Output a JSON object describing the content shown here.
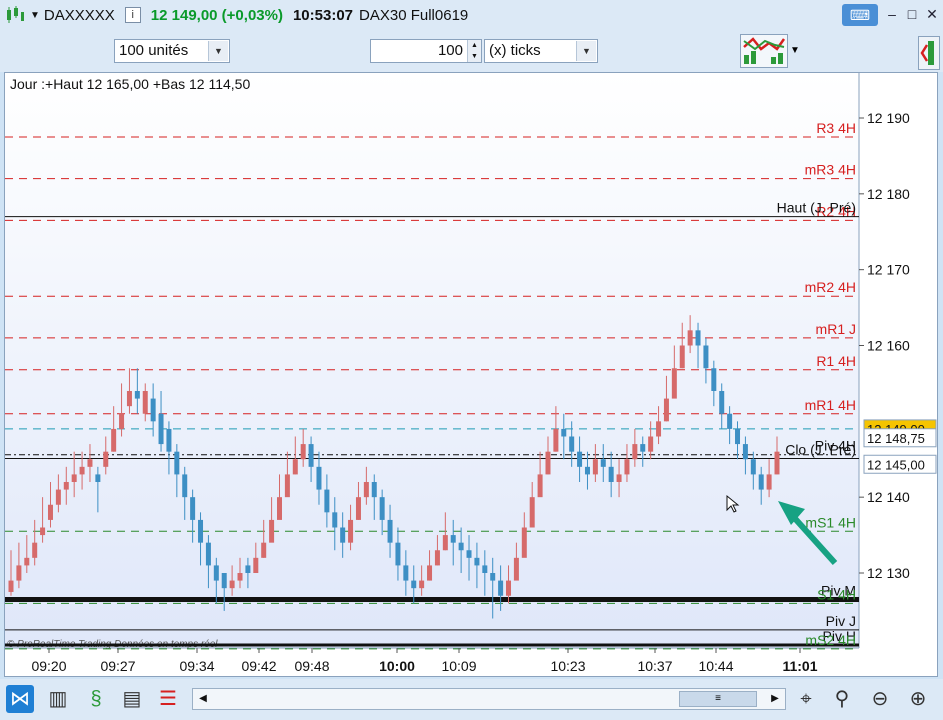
{
  "titlebar": {
    "symbol": "DAXXXXX",
    "info": "i",
    "price": "12 149,00 (+0,03%)",
    "time": "10:53:07",
    "instrument": "DAX30 Full0619",
    "min": "–",
    "max": "□",
    "close": "✕"
  },
  "toolbar": {
    "units_value": "100 unités",
    "ticks_value": "100",
    "ticks_mode": "(x) ticks"
  },
  "chart": {
    "header": "Jour :+Haut 12 165,00 +Bas 12 114,50",
    "watermark": "© ProRealTime Trading Données en temps réel",
    "y_ticks": [
      {
        "v": 12190,
        "label": "12 190"
      },
      {
        "v": 12180,
        "label": "12 180"
      },
      {
        "v": 12170,
        "label": "12 170"
      },
      {
        "v": 12160,
        "label": "12 160"
      },
      {
        "v": 12140,
        "label": "12 140"
      },
      {
        "v": 12130,
        "label": "12 130"
      }
    ],
    "x_ticks": [
      {
        "label": "09:20",
        "bold": false
      },
      {
        "label": "09:27",
        "bold": false
      },
      {
        "label": "09:34",
        "bold": false
      },
      {
        "label": "09:42",
        "bold": false
      },
      {
        "label": "09:48",
        "bold": false
      },
      {
        "label": "10:00",
        "bold": true
      },
      {
        "label": "10:09",
        "bold": false
      },
      {
        "label": "10:23",
        "bold": false
      },
      {
        "label": "10:37",
        "bold": false
      },
      {
        "label": "10:44",
        "bold": false
      },
      {
        "label": "11:01",
        "bold": true
      }
    ],
    "price_tags": [
      {
        "label": "12 149,00",
        "v": 12149,
        "bg": "#f5c400"
      },
      {
        "label": "12 148,75",
        "v": 12147.7,
        "bg": "#ffffff"
      },
      {
        "label": "12 145,00",
        "v": 12145,
        "bg": "#ffffff"
      }
    ],
    "levels": [
      {
        "label": "R3 4H",
        "v": 12187.5,
        "color": "#d62020",
        "style": "dash"
      },
      {
        "label": "mR3 4H",
        "v": 12182,
        "color": "#d62020",
        "style": "dash"
      },
      {
        "label": "R2 4H",
        "v": 12176.5,
        "color": "#d62020",
        "style": "dash"
      },
      {
        "label": "Haut (J. Pré)",
        "v": 12177,
        "color": "#111111",
        "style": "solid"
      },
      {
        "label": "mR2 4H",
        "v": 12166.5,
        "color": "#d62020",
        "style": "dash"
      },
      {
        "label": "mR1 J",
        "v": 12161,
        "color": "#d62020",
        "style": "dash"
      },
      {
        "label": "R1 4H",
        "v": 12156.8,
        "color": "#d62020",
        "style": "dash"
      },
      {
        "label": "mR1 4H",
        "v": 12151,
        "color": "#d62020",
        "style": "dash"
      },
      {
        "label": "",
        "v": 12149,
        "color": "#1f9bb5",
        "style": "dash"
      },
      {
        "label": "Piv 4H",
        "v": 12145.6,
        "color": "#111111",
        "style": "dashdot"
      },
      {
        "label": "Clo (J. Pré)",
        "v": 12145.1,
        "color": "#111111",
        "style": "solid"
      },
      {
        "label": "mS1 4H",
        "v": 12135.5,
        "color": "#2a8a2a",
        "style": "dash"
      },
      {
        "label": "Piv M",
        "v": 12126.5,
        "color": "#111111",
        "style": "thick"
      },
      {
        "label": "S1 4H",
        "v": 12126,
        "color": "#2a8a2a",
        "style": "dash"
      },
      {
        "label": "Piv J",
        "v": 12122.5,
        "color": "#111111",
        "style": "solid"
      },
      {
        "label": "Piv H",
        "v": 12120.5,
        "color": "#111111",
        "style": "thick2"
      },
      {
        "label": "mS2 4H",
        "v": 12120,
        "color": "#2a8a2a",
        "style": "dash"
      }
    ],
    "colors": {
      "up": "#3d8fc4",
      "down": "#d66a6a",
      "bg_top": "#ffffff",
      "bg_bottom": "#dfe7f9"
    }
  },
  "chart_data": {
    "type": "candlestick",
    "x_labels": [
      "09:20",
      "09:27",
      "09:34",
      "09:42",
      "09:48",
      "10:00",
      "10:09",
      "10:23",
      "10:37",
      "10:44",
      "11:01"
    ],
    "ylim": [
      12115,
      12198
    ],
    "candles": [
      [
        12129,
        12133,
        12127,
        12127.5
      ],
      [
        12131,
        12134,
        12128,
        12129
      ],
      [
        12132,
        12135,
        12130,
        12131
      ],
      [
        12134,
        12137,
        12131,
        12132
      ],
      [
        12136,
        12140,
        12134,
        12135
      ],
      [
        12139,
        12142,
        12136,
        12137
      ],
      [
        12141,
        12143,
        12138,
        12139
      ],
      [
        12142,
        12144,
        12139,
        12141
      ],
      [
        12143,
        12146,
        12140,
        12142
      ],
      [
        12144,
        12146,
        12141,
        12143
      ],
      [
        12145,
        12147,
        12142,
        12144
      ],
      [
        12142,
        12144,
        12138,
        12143
      ],
      [
        12146,
        12148,
        12143,
        12144
      ],
      [
        12149,
        12152,
        12146,
        12146
      ],
      [
        12151,
        12155,
        12148,
        12149
      ],
      [
        12154,
        12157,
        12151,
        12152
      ],
      [
        12153,
        12157,
        12151,
        12154
      ],
      [
        12154,
        12155,
        12150,
        12151
      ],
      [
        12150,
        12155,
        12148,
        12153
      ],
      [
        12147,
        12154,
        12146,
        12151
      ],
      [
        12146,
        12150,
        12143,
        12149
      ],
      [
        12143,
        12147,
        12140,
        12146
      ],
      [
        12140,
        12144,
        12137,
        12143
      ],
      [
        12137,
        12141,
        12134,
        12140
      ],
      [
        12134,
        12138,
        12131,
        12137
      ],
      [
        12131,
        12135,
        12128,
        12134
      ],
      [
        12129,
        12132,
        12126,
        12131
      ],
      [
        12128,
        12130,
        12125,
        12130
      ],
      [
        12129,
        12131,
        12127,
        12128
      ],
      [
        12130,
        12132,
        12128,
        12129
      ],
      [
        12130,
        12132,
        12128,
        12131
      ],
      [
        12132,
        12134,
        12130,
        12130
      ],
      [
        12134,
        12137,
        12132,
        12132
      ],
      [
        12137,
        12140,
        12135,
        12134
      ],
      [
        12140,
        12143,
        12138,
        12137
      ],
      [
        12143,
        12146,
        12141,
        12140
      ],
      [
        12145,
        12148,
        12143,
        12143
      ],
      [
        12147,
        12149,
        12144,
        12145
      ],
      [
        12144,
        12148,
        12142,
        12147
      ],
      [
        12141,
        12146,
        12139,
        12144
      ],
      [
        12138,
        12143,
        12136,
        12141
      ],
      [
        12136,
        12140,
        12133,
        12138
      ],
      [
        12134,
        12138,
        12132,
        12136
      ],
      [
        12137,
        12139,
        12133,
        12134
      ],
      [
        12140,
        12142,
        12137,
        12137
      ],
      [
        12142,
        12144,
        12139,
        12140
      ],
      [
        12140,
        12143,
        12137,
        12142
      ],
      [
        12137,
        12141,
        12135,
        12140
      ],
      [
        12134,
        12139,
        12132,
        12137
      ],
      [
        12131,
        12136,
        12129,
        12134
      ],
      [
        12129,
        12133,
        12127,
        12131
      ],
      [
        12128,
        12131,
        12126,
        12129
      ],
      [
        12129,
        12131,
        12127,
        12128
      ],
      [
        12131,
        12133,
        12129,
        12129
      ],
      [
        12133,
        12135,
        12131,
        12131
      ],
      [
        12135,
        12138,
        12133,
        12133
      ],
      [
        12134,
        12137,
        12131,
        12135
      ],
      [
        12133,
        12136,
        12130,
        12134
      ],
      [
        12132,
        12135,
        12129,
        12133
      ],
      [
        12131,
        12134,
        12128,
        12132
      ],
      [
        12130,
        12133,
        12127,
        12131
      ],
      [
        12129,
        12132,
        12124,
        12130
      ],
      [
        12127,
        12131,
        12125,
        12129
      ],
      [
        12129,
        12131,
        12126,
        12127
      ],
      [
        12132,
        12134,
        12130,
        12129
      ],
      [
        12136,
        12138,
        12134,
        12132
      ],
      [
        12140,
        12142,
        12137,
        12136
      ],
      [
        12143,
        12146,
        12141,
        12140
      ],
      [
        12146,
        12148,
        12143,
        12143
      ],
      [
        12149,
        12152,
        12146,
        12146
      ],
      [
        12148,
        12151,
        12145,
        12149
      ],
      [
        12146,
        12150,
        12144,
        12148
      ],
      [
        12144,
        12148,
        12142,
        12146
      ],
      [
        12143,
        12146,
        12141,
        12144
      ],
      [
        12145,
        12147,
        12142,
        12143
      ],
      [
        12144,
        12147,
        12142,
        12145
      ],
      [
        12142,
        12146,
        12140,
        12144
      ],
      [
        12143,
        12145,
        12140,
        12142
      ],
      [
        12145,
        12147,
        12142,
        12143
      ],
      [
        12147,
        12149,
        12144,
        12145
      ],
      [
        12146,
        12148,
        12144,
        12147
      ],
      [
        12148,
        12150,
        12145,
        12146
      ],
      [
        12150,
        12152,
        12147,
        12148
      ],
      [
        12153,
        12156,
        12150,
        12150
      ],
      [
        12157,
        12160,
        12154,
        12153
      ],
      [
        12160,
        12163,
        12157,
        12157
      ],
      [
        12162,
        12164,
        12159,
        12160
      ],
      [
        12160,
        12163,
        12157,
        12162
      ],
      [
        12157,
        12161,
        12155,
        12160
      ],
      [
        12154,
        12158,
        12152,
        12157
      ],
      [
        12151,
        12155,
        12149,
        12154
      ],
      [
        12149,
        12152,
        12147,
        12151
      ],
      [
        12147,
        12150,
        12145,
        12149
      ],
      [
        12145,
        12148,
        12143,
        12147
      ],
      [
        12143,
        12146,
        12141,
        12145
      ],
      [
        12141,
        12144,
        12139,
        12143
      ],
      [
        12143,
        12145,
        12140,
        12141
      ],
      [
        12146,
        12148,
        12143,
        12143
      ]
    ]
  },
  "bottom": {
    "scroll_thumb": "≡"
  }
}
